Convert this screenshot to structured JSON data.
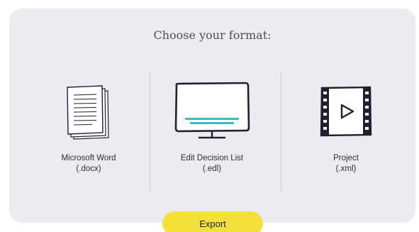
{
  "dialog": {
    "title": "Choose your format:"
  },
  "colors": {
    "panel_bg": "#ebebf0",
    "export_button": "#f3e13a",
    "accent_teal": "#3fb8c4",
    "ink": "#1f2130"
  },
  "formats": [
    {
      "icon": "document-icon",
      "name": "Microsoft Word",
      "extension": "(.docx)"
    },
    {
      "icon": "monitor-icon",
      "name": "Edit Decision List",
      "extension": "(.edl)"
    },
    {
      "icon": "film-play-icon",
      "name": "Project",
      "extension": "(.xml)"
    }
  ],
  "actions": {
    "export_label": "Export"
  }
}
